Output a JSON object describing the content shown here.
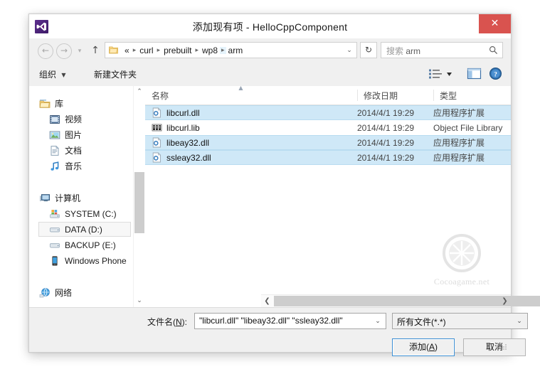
{
  "window": {
    "title": "添加现有项 - HelloCppComponent",
    "app_icon": "visual-studio-icon",
    "close_label": "✕"
  },
  "nav": {
    "back_icon": "←",
    "forward_icon": "→",
    "history_icon": "▾",
    "up_icon": "↑",
    "refresh_icon": "↻",
    "breadcrumb_prefix": "«",
    "breadcrumb": [
      "curl",
      "prebuilt",
      "wp8",
      "arm"
    ],
    "breadcrumb_separator": "▸",
    "address_caret": "⌄",
    "search_placeholder_prefix": "搜索 ",
    "search_placeholder_scope": "arm",
    "search_icon": "search-icon"
  },
  "toolbar": {
    "organize_label": "组织",
    "organize_caret": "▼",
    "new_folder_label": "新建文件夹",
    "view_caret": "▼",
    "view_icon": "view-list-icon",
    "preview_pane_icon": "preview-pane-icon",
    "help_icon": "help-icon"
  },
  "sidebar": {
    "groups": [
      {
        "label": "库",
        "icon": "library-folder-icon",
        "items": [
          {
            "label": "视频",
            "icon": "video-icon"
          },
          {
            "label": "图片",
            "icon": "pictures-icon"
          },
          {
            "label": "文档",
            "icon": "documents-icon"
          },
          {
            "label": "音乐",
            "icon": "music-icon"
          }
        ]
      },
      {
        "label": "计算机",
        "icon": "computer-icon",
        "items": [
          {
            "label": "SYSTEM (C:)",
            "icon": "system-drive-icon",
            "selected": false
          },
          {
            "label": "DATA (D:)",
            "icon": "drive-icon",
            "selected": true
          },
          {
            "label": "BACKUP (E:)",
            "icon": "drive-icon",
            "selected": false
          },
          {
            "label": "Windows Phone",
            "icon": "phone-icon",
            "selected": false
          }
        ]
      },
      {
        "label": "网络",
        "icon": "network-icon",
        "items": []
      }
    ],
    "scroll_up_icon": "⌃",
    "scroll_down_icon": "⌄"
  },
  "filelist": {
    "columns": [
      "名称",
      "修改日期",
      "类型"
    ],
    "sort_indicator": "▲",
    "rows": [
      {
        "name": "libcurl.dll",
        "date": "2014/4/1 19:29",
        "type": "应用程序扩展",
        "icon": "dll-icon",
        "selected": true
      },
      {
        "name": "libcurl.lib",
        "date": "2014/4/1 19:29",
        "type": "Object File Library",
        "icon": "lib-icon",
        "selected": false
      },
      {
        "name": "libeay32.dll",
        "date": "2014/4/1 19:29",
        "type": "应用程序扩展",
        "icon": "dll-icon",
        "selected": true
      },
      {
        "name": "ssleay32.dll",
        "date": "2014/4/1 19:29",
        "type": "应用程序扩展",
        "icon": "dll-icon",
        "selected": true
      }
    ],
    "hscroll_left_icon": "❮",
    "hscroll_right_icon": "❯"
  },
  "watermark": {
    "text": "Cocoagame.net",
    "icon": "citrus-wheel-icon"
  },
  "footer": {
    "filename_label_prefix": "文件名(",
    "filename_label_key": "N",
    "filename_label_suffix": "):",
    "filename_value": "\"libcurl.dll\" \"libeay32.dll\" \"ssleay32.dll\"",
    "filename_caret": "⌄",
    "filetype_value": "所有文件(*.*)",
    "filetype_caret": "⌄",
    "add_label_prefix": "添加(",
    "add_label_key": "A",
    "add_label_suffix": ")",
    "cancel_label": "取消"
  },
  "colors": {
    "selection": "#cfe8f7",
    "close_red": "#d9534f",
    "default_button_border": "#3c8fd4",
    "vs_purple": "#68217a"
  }
}
